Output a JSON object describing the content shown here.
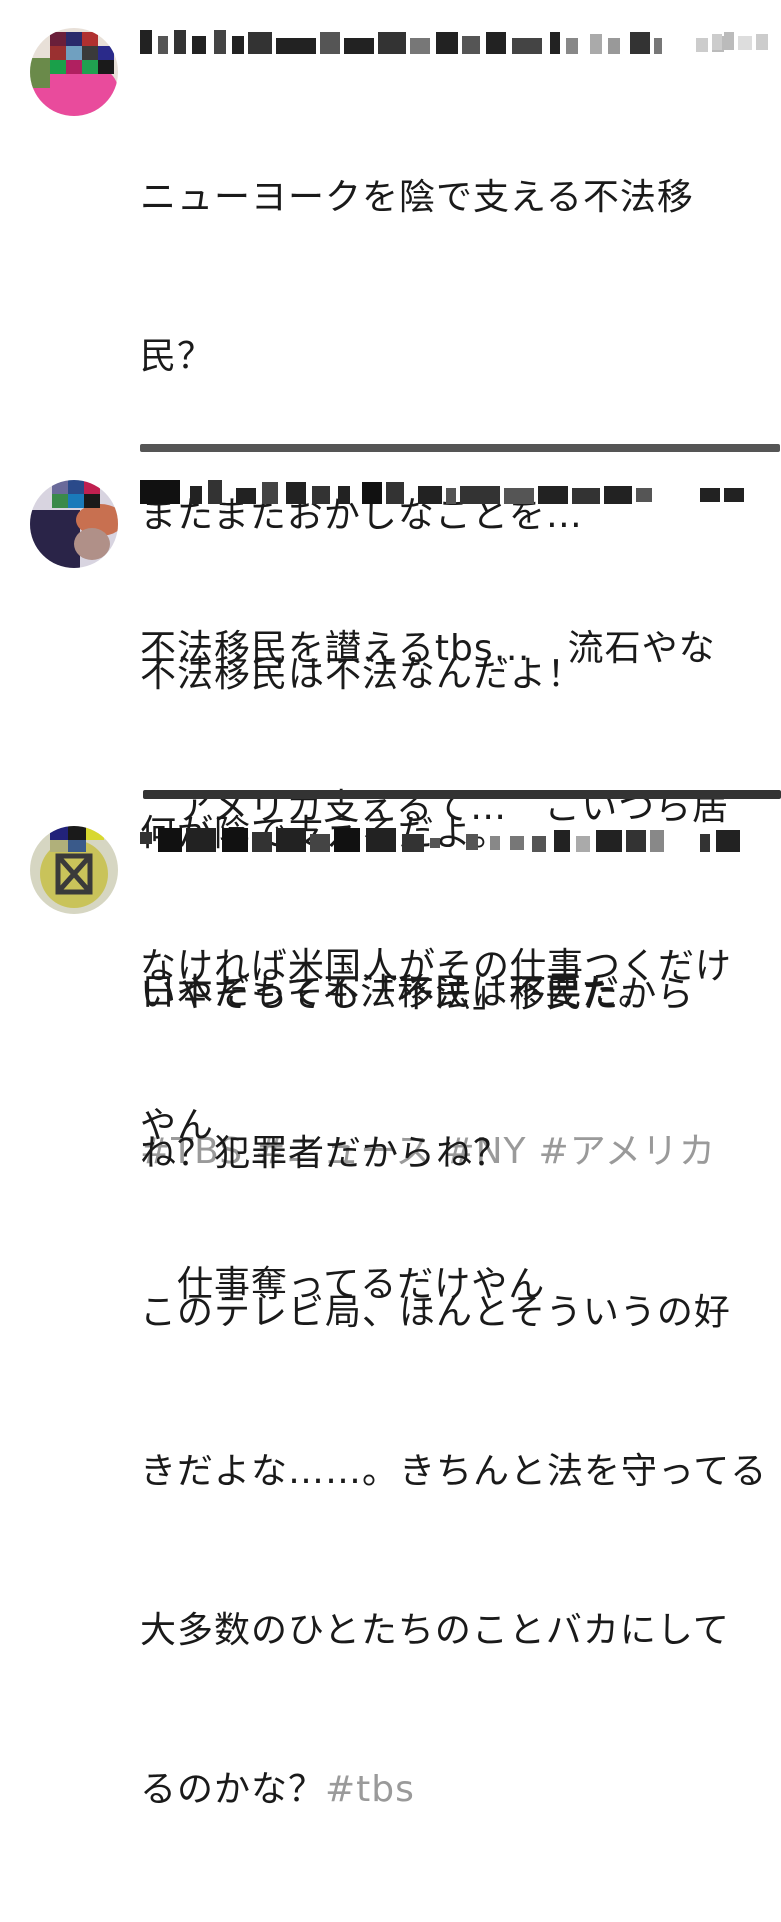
{
  "posts": [
    {
      "lines": [
        "ニューヨークを陰で支える不法移",
        "民？",
        "またまたおかしなことを…",
        "不法移民は不法なんだよ！",
        "何が陰で支えるだよ。",
        "日本だって不法移民は不要だ。"
      ],
      "hashtags": [
        "#TBS",
        "#ニュース",
        "#NY",
        "#アメリカ"
      ]
    },
    {
      "lines": [
        "不法移民を讃えるtbs…　流石やな",
        "　アメリカ支えるて…　こいつら居",
        "なければ米国人がその仕事つくだけ",
        "やん",
        "　仕事奪ってるだけやん"
      ]
    },
    {
      "lines": [
        "いやそもそも「不法」移民だから",
        "ね？犯罪者だからね？",
        "このテレビ局、ほんとそういうの好",
        "きだよな……。きちんと法を守ってる",
        "大多数のひとたちのことバカにして"
      ],
      "last_line": "るのかな？",
      "hashtags": [
        "#tbs"
      ]
    }
  ],
  "colors": {
    "text": "#1a1a1a",
    "hashtag": "#9a9a9a",
    "divider": "#3a3a3a"
  }
}
